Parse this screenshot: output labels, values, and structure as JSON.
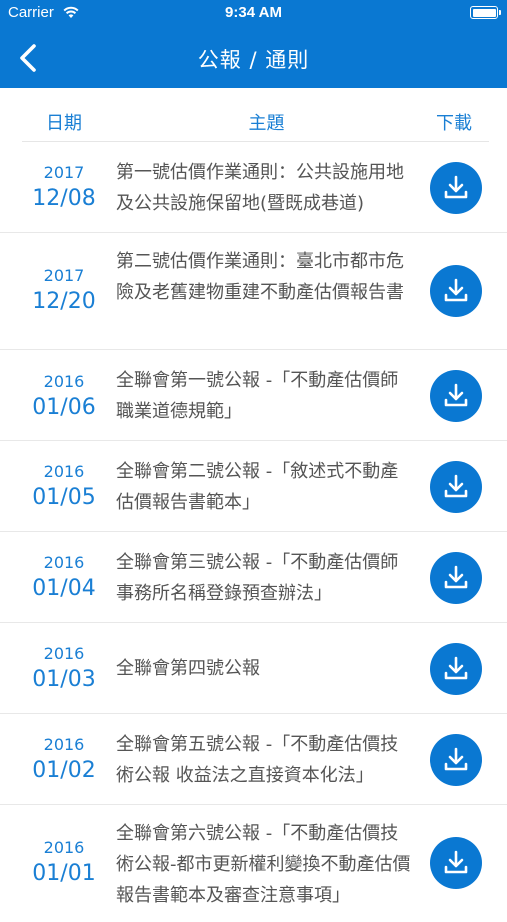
{
  "status": {
    "carrier": "Carrier",
    "time": "9:34 AM"
  },
  "nav": {
    "title": "公報 / 通則"
  },
  "columns": {
    "date": "日期",
    "subject": "主題",
    "download": "下載"
  },
  "rows": [
    {
      "year": "2017",
      "md": "12/08",
      "subject": "第一號估價作業通則：公共設施用地及公共設施保留地(暨既成巷道)"
    },
    {
      "year": "2017",
      "md": "12/20",
      "subject": "第二號估價作業通則：臺北市都市危險及老舊建物重建不動產估價報告書"
    },
    {
      "year": "2016",
      "md": "01/06",
      "subject": "全聯會第一號公報 -「不動產估價師職業道德規範」"
    },
    {
      "year": "2016",
      "md": "01/05",
      "subject": "全聯會第二號公報 -「敘述式不動產估價報告書範本」"
    },
    {
      "year": "2016",
      "md": "01/04",
      "subject": "全聯會第三號公報 -「不動產估價師事務所名稱登錄預查辦法」"
    },
    {
      "year": "2016",
      "md": "01/03",
      "subject": "全聯會第四號公報"
    },
    {
      "year": "2016",
      "md": "01/02",
      "subject": "全聯會第五號公報 -「不動產估價技術公報 收益法之直接資本化法」"
    },
    {
      "year": "2016",
      "md": "01/01",
      "subject": "全聯會第六號公報 -「不動產估價技術公報-都市更新權利變換不動產估價報告書範本及審查注意事項」"
    }
  ]
}
